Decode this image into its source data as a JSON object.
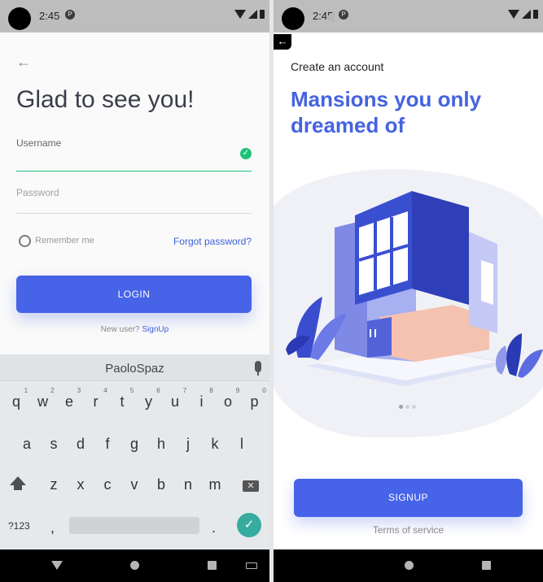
{
  "status": {
    "time": "2:45",
    "badge": "P"
  },
  "back_tag_glyph": "←",
  "login": {
    "back_arrow": "←",
    "title": "Glad to see you!",
    "username_label": "Username",
    "password_label": "Password",
    "remember_label": "Remember me",
    "forgot_label": "Forgot password?",
    "login_button": "LOGIN",
    "new_user_text": "New user?",
    "signup_link": "SignUp"
  },
  "keyboard": {
    "suggestion": "PaoloSpaz",
    "row1": [
      "q",
      "w",
      "e",
      "r",
      "t",
      "y",
      "u",
      "i",
      "o",
      "p"
    ],
    "row1_nums": [
      "1",
      "2",
      "3",
      "4",
      "5",
      "6",
      "7",
      "8",
      "9",
      "0"
    ],
    "row2": [
      "a",
      "s",
      "d",
      "f",
      "g",
      "h",
      "j",
      "k",
      "l"
    ],
    "row3": [
      "z",
      "x",
      "c",
      "v",
      "b",
      "n",
      "m"
    ],
    "symbols_key": "?123",
    "comma": ",",
    "period": ".",
    "enter_glyph": "✓",
    "backspace_glyph": "✕"
  },
  "signup": {
    "subtitle": "Create an account",
    "headline": "Mansions you only dreamed of",
    "button": "SIGNUP",
    "terms": "Terms of service",
    "page_count": 3,
    "active_page": 1
  },
  "colors": {
    "accent": "#4763e8",
    "headline": "#4563e0",
    "success": "#20c278",
    "enter_key": "#36aba0"
  }
}
